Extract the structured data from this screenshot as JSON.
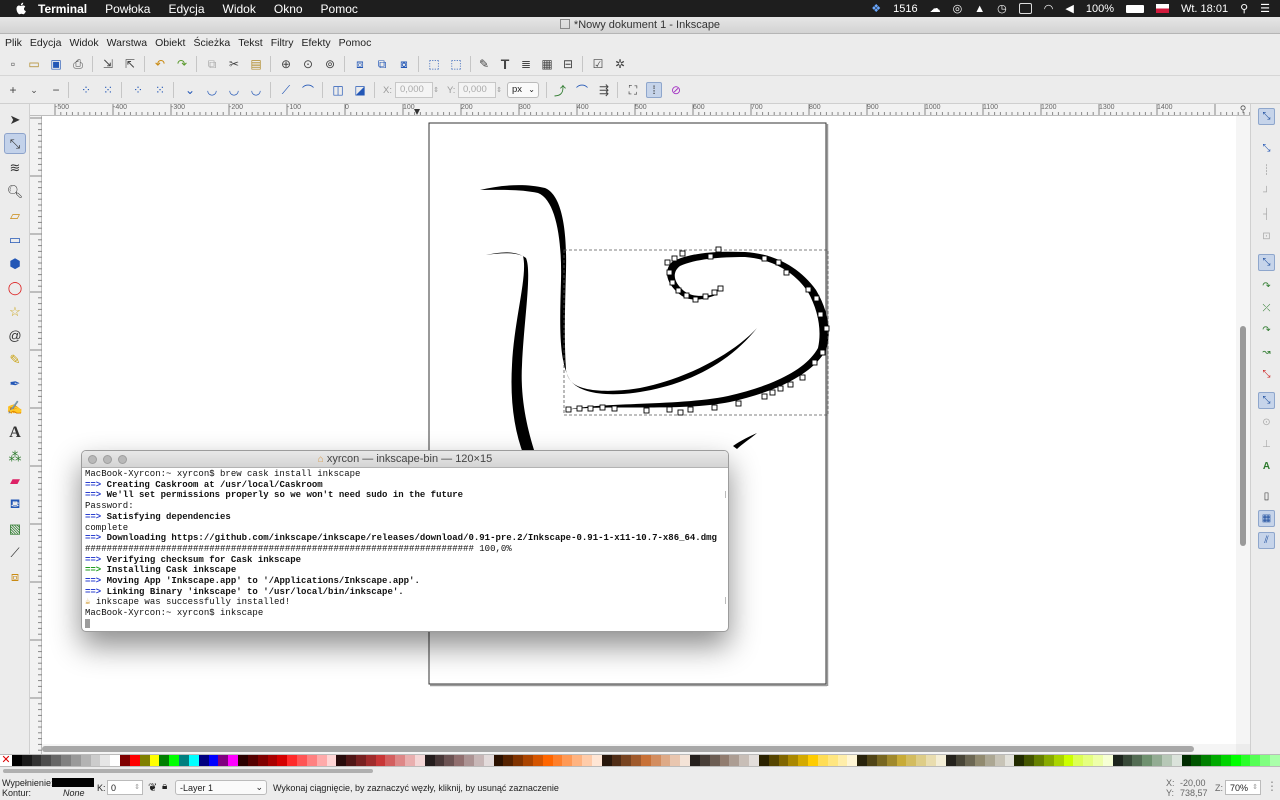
{
  "macbar": {
    "app": "Terminal",
    "menus": [
      "Powłoka",
      "Edycja",
      "Widok",
      "Okno",
      "Pomoc"
    ],
    "badge": "1516",
    "battery": "100%",
    "clock": "Wt. 18:01"
  },
  "window_title": "*Nowy dokument 1 - Inkscape",
  "app_menu": [
    "Plik",
    "Edycja",
    "Widok",
    "Warstwa",
    "Obiekt",
    "Ścieżka",
    "Tekst",
    "Filtry",
    "Efekty",
    "Pomoc"
  ],
  "node_toolbar": {
    "x_label": "X:",
    "x_value": "0,000",
    "y_label": "Y:",
    "y_value": "0,000",
    "unit": "px"
  },
  "ruler_labels": [
    "-500",
    "-400",
    "-300",
    "-200",
    "-100",
    "0",
    "100",
    "200",
    "300",
    "400",
    "500",
    "600",
    "700",
    "800",
    "900",
    "1000",
    "1100",
    "1200",
    "1300",
    "1400"
  ],
  "terminal": {
    "title": "xyrcon — inkscape-bin — 120×15",
    "lines": [
      {
        "t": "plain",
        "text": "MacBook-Xyrcon:~ xyrcon$ brew cask install inkscape"
      },
      {
        "t": "arrow",
        "text": "Creating Caskroom at /usr/local/Caskroom"
      },
      {
        "t": "arrow",
        "text": "We'll set permissions properly so we won't need sudo in the future"
      },
      {
        "t": "plain",
        "text": "Password:"
      },
      {
        "t": "arrow",
        "text": "Satisfying dependencies"
      },
      {
        "t": "plain",
        "text": "complete"
      },
      {
        "t": "arrow",
        "text": "Downloading https://github.com/inkscape/inkscape/releases/download/0.91-pre.2/Inkscape-0.91-1-x11-10.7-x86_64.dmg"
      },
      {
        "t": "plain",
        "text": "######################################################################## 100,0%"
      },
      {
        "t": "arrow",
        "text": "Verifying checksum for Cask inkscape"
      },
      {
        "t": "arrowg",
        "text": "Installing Cask inkscape"
      },
      {
        "t": "arrow",
        "text": "Moving App 'Inkscape.app' to '/Applications/Inkscape.app'."
      },
      {
        "t": "arrow",
        "text": "Linking Binary 'inkscape' to '/usr/local/bin/inkscape'."
      },
      {
        "t": "beer",
        "text": "inkscape was successfully installed!"
      },
      {
        "t": "plain",
        "text": "MacBook-Xyrcon:~ xyrcon$ inkscape"
      }
    ]
  },
  "status": {
    "fill_label": "Wypełnienie:",
    "stroke_label": "Kontur:",
    "stroke_value": "None",
    "opacity_label": "K:",
    "opacity_value": "0",
    "layer": "-Layer 1",
    "message": "Wykonaj ciągnięcie, by zaznaczyć węzły, kliknij, by usunąć zaznaczenie",
    "coord_x_label": "X:",
    "coord_x": "-20,00",
    "coord_y_label": "Y:",
    "coord_y": "738,57",
    "zoom_label": "Z:",
    "zoom": "70%"
  },
  "colors": {
    "accent": "#2357b6",
    "stroke": "#000000"
  }
}
